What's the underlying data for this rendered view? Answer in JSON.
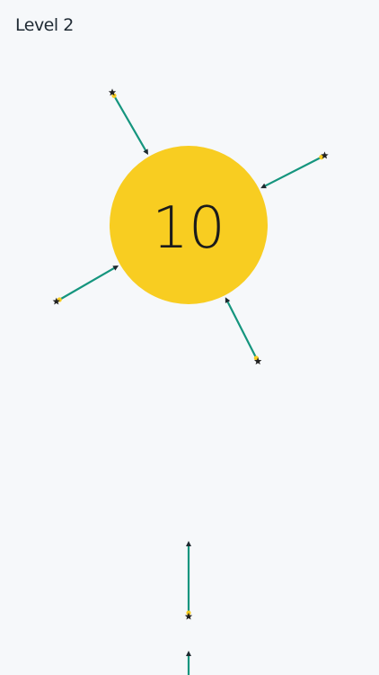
{
  "hud": {
    "level_label": "Level 2"
  },
  "target": {
    "remaining_count": "10",
    "color": "#F8CD21",
    "text_color": "#1B1B1B"
  },
  "pins": {
    "shaft_color": "#15957E",
    "star_color": "#222222",
    "stub_color": "#F8CD21",
    "stuck_angles_deg": [
      240,
      333,
      150,
      63
    ],
    "queue_count": 2
  }
}
